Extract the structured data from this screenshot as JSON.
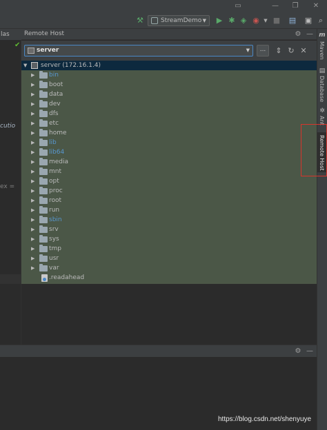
{
  "toolbar": {
    "run_config_label": "StreamDemo",
    "icons": [
      "hammer-icon",
      "run-icon",
      "debug-icon",
      "coverage-icon",
      "profile-icon",
      "stop-icon",
      "project-structure-icon",
      "terminal-icon"
    ]
  },
  "editor": {
    "tab_fragment": "las",
    "code_fragments": [
      "cutio",
      "ex ="
    ]
  },
  "remote_host": {
    "title": "Remote Host",
    "selected_server": "server",
    "browse_label": "...",
    "root_label": "server (172.16.1.4)",
    "items": [
      {
        "label": "bin",
        "type": "folder",
        "link": true
      },
      {
        "label": "boot",
        "type": "folder",
        "link": false
      },
      {
        "label": "data",
        "type": "folder",
        "link": false
      },
      {
        "label": "dev",
        "type": "folder",
        "link": false
      },
      {
        "label": "dfs",
        "type": "folder",
        "link": false
      },
      {
        "label": "etc",
        "type": "folder",
        "link": false
      },
      {
        "label": "home",
        "type": "folder",
        "link": false
      },
      {
        "label": "lib",
        "type": "folder",
        "link": true
      },
      {
        "label": "lib64",
        "type": "folder",
        "link": true
      },
      {
        "label": "media",
        "type": "folder",
        "link": false
      },
      {
        "label": "mnt",
        "type": "folder",
        "link": false
      },
      {
        "label": "opt",
        "type": "folder",
        "link": false
      },
      {
        "label": "proc",
        "type": "folder",
        "link": false
      },
      {
        "label": "root",
        "type": "folder",
        "link": false
      },
      {
        "label": "run",
        "type": "folder",
        "link": false
      },
      {
        "label": "sbin",
        "type": "folder",
        "link": true
      },
      {
        "label": "srv",
        "type": "folder",
        "link": false
      },
      {
        "label": "sys",
        "type": "folder",
        "link": false
      },
      {
        "label": "tmp",
        "type": "folder",
        "link": false
      },
      {
        "label": "usr",
        "type": "folder",
        "link": false
      },
      {
        "label": "var",
        "type": "folder",
        "link": false
      },
      {
        "label": ".readahead",
        "type": "file",
        "link": false
      }
    ]
  },
  "right_tabs": {
    "maven": "Maven",
    "database": "Database",
    "ant": "Ant",
    "remote_host": "Remote Host"
  },
  "colors": {
    "tree_background": "#4b5747",
    "tree_selection": "#0d293e",
    "link_text": "#5897cf",
    "normal_text": "#bbbbbb",
    "highlight_box": "#d8342c"
  },
  "watermark": "https://blog.csdn.net/shenyuye"
}
